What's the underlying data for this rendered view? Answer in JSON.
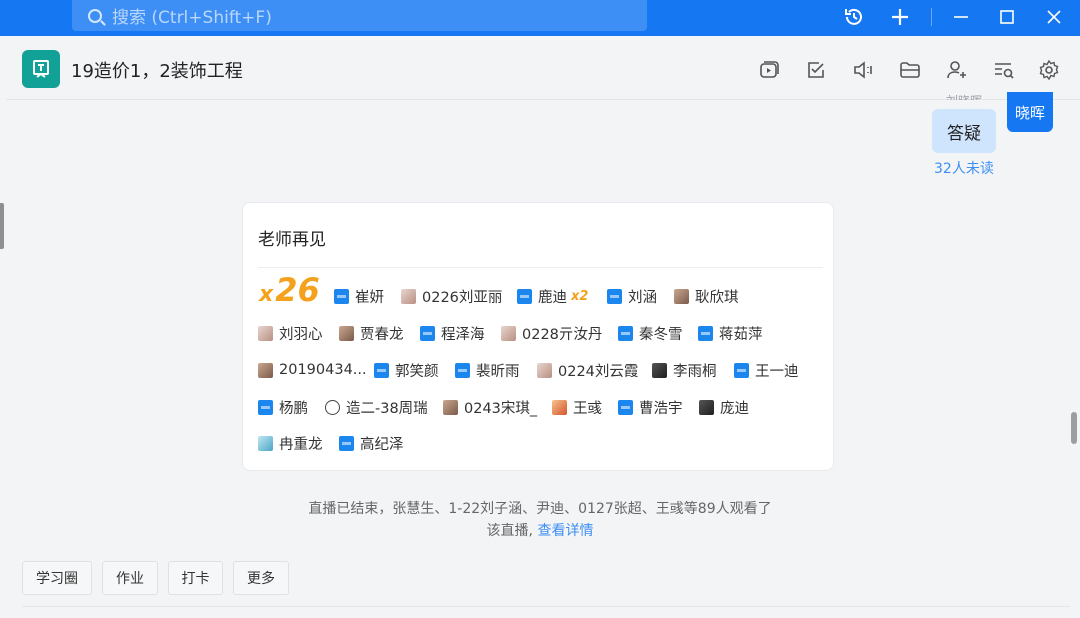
{
  "window": {
    "search_placeholder": "搜索 (Ctrl+Shift+F)",
    "buttons": [
      "history-icon",
      "add-icon",
      "minimize-icon",
      "maximize-icon",
      "close-icon"
    ]
  },
  "chat": {
    "title": "19造价1，2装饰工程",
    "header_icons": [
      "live-video-icon",
      "task-check-icon",
      "mute-speaker-icon",
      "folder-icon",
      "add-member-icon",
      "search-history-icon",
      "settings-icon"
    ]
  },
  "messages": {
    "cut_sender": "刘晓晖",
    "bubble_text": "答疑",
    "unread": "32人未读",
    "sender_avatar": "晓晖"
  },
  "card": {
    "title": "老师再见",
    "count_prefix": "x",
    "count": "26",
    "people": [
      {
        "name": "崔妍",
        "avatar": "blue"
      },
      {
        "name": "0226刘亚丽",
        "avatar": "photo2"
      },
      {
        "name": "鹿迪",
        "avatar": "blue",
        "mult": "x2"
      },
      {
        "name": "刘涵",
        "avatar": "blue"
      },
      {
        "name": "耿欣琪",
        "avatar": "photo"
      },
      {
        "name": "刘羽心",
        "avatar": "photo2"
      },
      {
        "name": "贾春龙",
        "avatar": "photo"
      },
      {
        "name": "程泽海",
        "avatar": "blue"
      },
      {
        "name": "0228亓汝丹",
        "avatar": "photo2"
      },
      {
        "name": "秦冬雪",
        "avatar": "blue"
      },
      {
        "name": "蒋茹萍",
        "avatar": "blue"
      },
      {
        "name": "20190434...",
        "avatar": "photo"
      },
      {
        "name": "郭笑颜",
        "avatar": "blue"
      },
      {
        "name": "裴昕雨",
        "avatar": "blue"
      },
      {
        "name": "0224刘云霞",
        "avatar": "photo2"
      },
      {
        "name": "李雨桐",
        "avatar": "dark"
      },
      {
        "name": "王一迪",
        "avatar": "blue"
      },
      {
        "name": "杨鹏",
        "avatar": "blue"
      },
      {
        "name": "造二-38周瑞",
        "avatar": "panda"
      },
      {
        "name": "0243宋琪_",
        "avatar": "photo"
      },
      {
        "name": "王彧",
        "avatar": "kid"
      },
      {
        "name": "曹浩宇",
        "avatar": "blue"
      },
      {
        "name": "庞迪",
        "avatar": "dark"
      },
      {
        "name": "冉重龙",
        "avatar": "cyan"
      },
      {
        "name": "高纪泽",
        "avatar": "blue"
      }
    ]
  },
  "notice": {
    "line1": "直播已结束，张慧生、1-22刘子涵、尹迪、0127张超、王彧等89人观看了",
    "line2": "该直播,",
    "link": "查看详情"
  },
  "actions": [
    "学习圈",
    "作业",
    "打卡",
    "更多"
  ]
}
